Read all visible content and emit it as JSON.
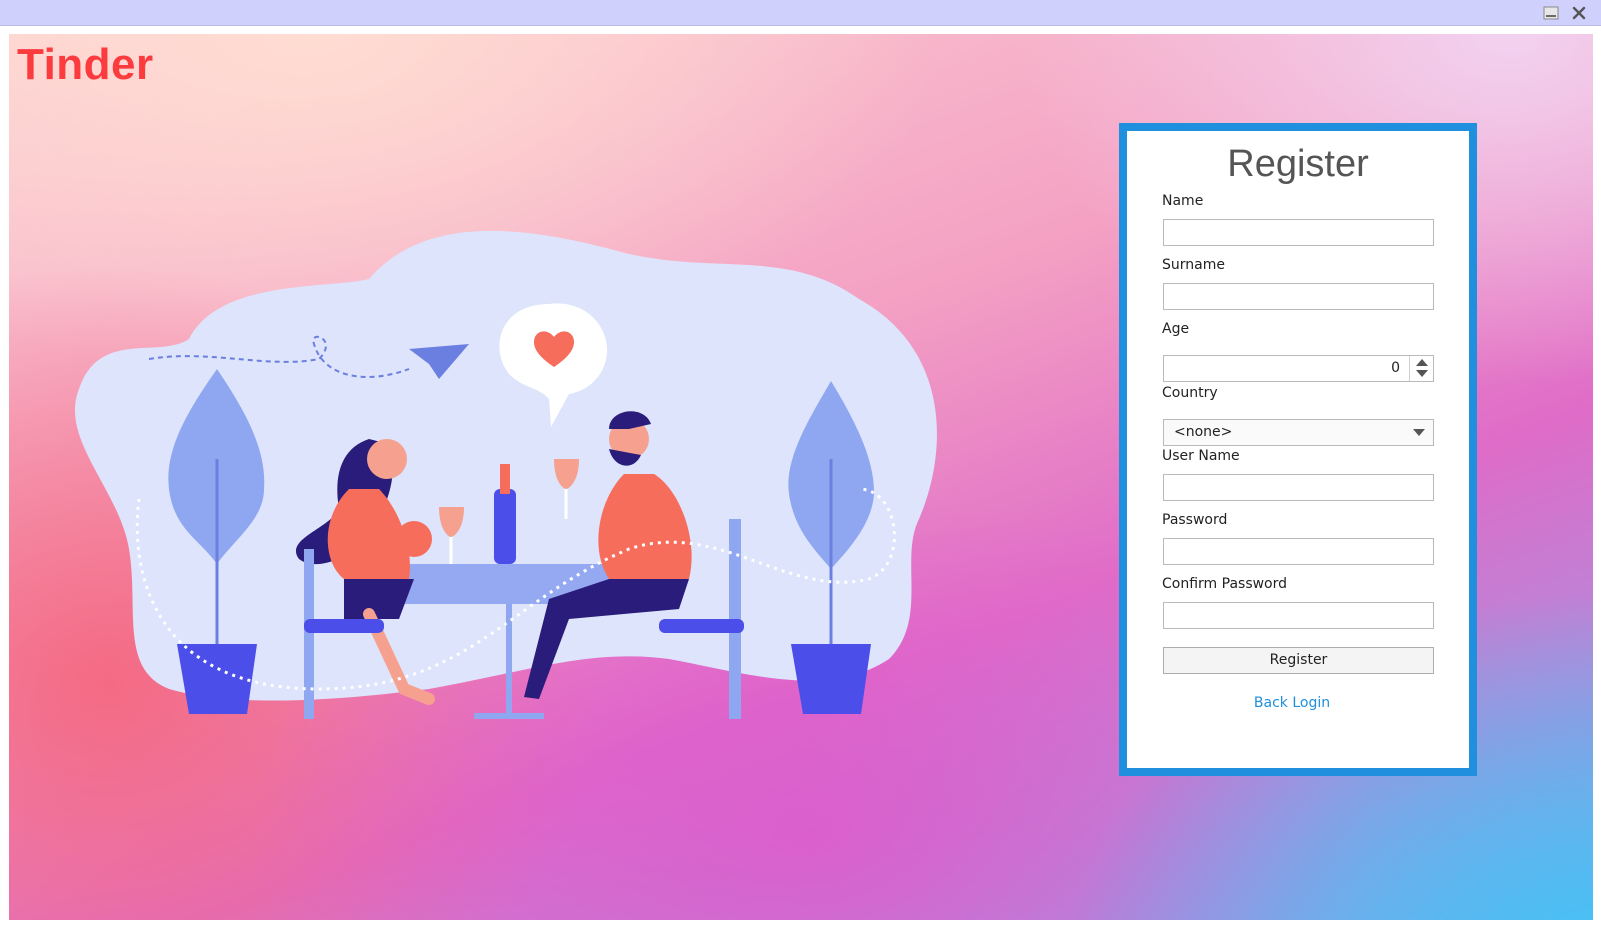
{
  "window": {
    "controls": {
      "minimize_icon": "minimize-icon",
      "close_icon": "close-icon"
    }
  },
  "app": {
    "logo": "Tinder",
    "brand_color": "#fb3b3e"
  },
  "illustration": {
    "heart_color": "#f66d5c"
  },
  "register": {
    "title": "Register",
    "accent_color": "#1f8fde",
    "fields": {
      "name_label": "Name",
      "surname_label": "Surname",
      "age_label": "Age",
      "age_value": "0",
      "country_label": "Country",
      "country_value": "<none>",
      "username_label": "User Name",
      "password_label": "Password",
      "confirm_password_label": "Confirm Password"
    },
    "button_label": "Register",
    "back_link": "Back Login"
  }
}
